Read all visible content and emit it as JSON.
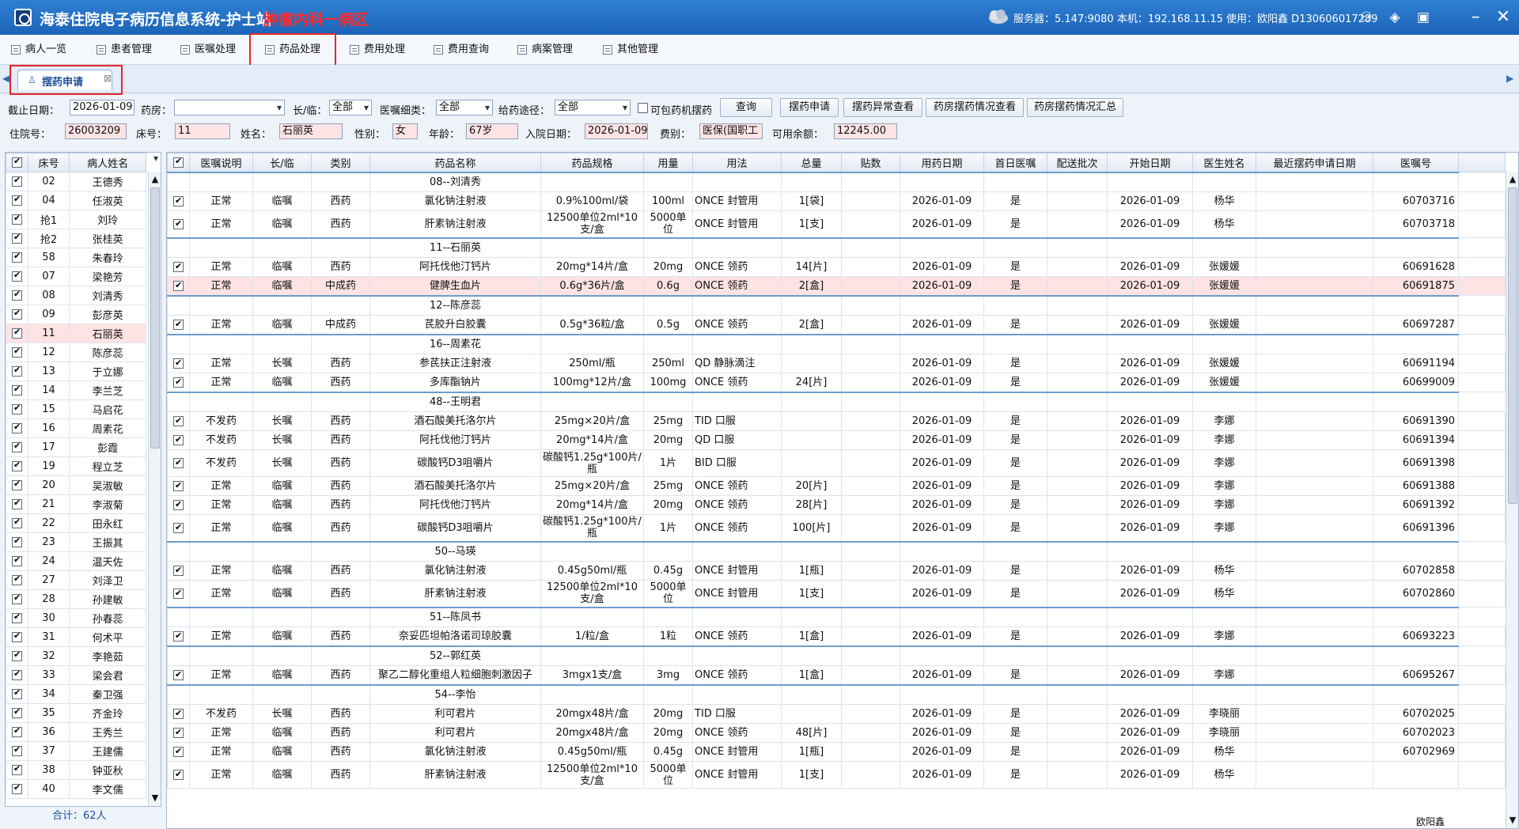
{
  "app": {
    "title": "海泰住院电子病历信息系统-护士站",
    "department": "肿瘤内科一病区",
    "server_info": "服务器：5.147:9080 本机：192.168.11.15 使用：欧阳鑫 D130606017289"
  },
  "menu": {
    "items": [
      "病人一览",
      "患者管理",
      "医嘱处理",
      "药品处理",
      "费用处理",
      "费用查询",
      "病案管理",
      "其他管理"
    ],
    "active_index": 3
  },
  "tab": {
    "label": "摆药申请",
    "close": "⊠"
  },
  "filters": {
    "cutoff_date_label": "截止日期：",
    "cutoff_date": "2026-01-09",
    "pharmacy_label": "药房：",
    "pharmacy": "",
    "longterm_label": "长/临：",
    "longterm": "全部",
    "order_type_label": "医嘱细类：",
    "order_type": "全部",
    "route_label": "给药途径：",
    "route": "全部",
    "include_machine_label": "可包药机摆药",
    "buttons": [
      "查询",
      "摆药申请",
      "摆药异常查看",
      "药房摆药情况查看",
      "药房摆药情况汇总"
    ]
  },
  "patient": {
    "inpatient_no_label": "住院号：",
    "inpatient_no": "26003209",
    "bed_label": "床号：",
    "bed": "11",
    "name_label": "姓名：",
    "name": "石丽英",
    "gender_label": "性别：",
    "gender": "女",
    "age_label": "年龄：",
    "age": "67岁",
    "admit_date_label": "入院日期：",
    "admit_date": "2026-01-09",
    "fee_type_label": "费别：",
    "fee_type": "医保(国职工",
    "balance_label": "可用余额：",
    "balance": "12245.00"
  },
  "left_grid": {
    "headers": [
      "床号",
      "病人姓名"
    ],
    "rows": [
      [
        "02",
        "王德秀"
      ],
      [
        "04",
        "任淑英"
      ],
      [
        "抢1",
        "刘玲"
      ],
      [
        "抢2",
        "张桂英"
      ],
      [
        "58",
        "朱春玲"
      ],
      [
        "07",
        "梁艳芳"
      ],
      [
        "08",
        "刘清秀"
      ],
      [
        "09",
        "彭彦英"
      ],
      [
        "11",
        "石丽英"
      ],
      [
        "12",
        "陈彦蕊"
      ],
      [
        "13",
        "于立娜"
      ],
      [
        "14",
        "李兰芝"
      ],
      [
        "15",
        "马启花"
      ],
      [
        "16",
        "周素花"
      ],
      [
        "17",
        "彭霞"
      ],
      [
        "19",
        "程立芝"
      ],
      [
        "20",
        "吴淑敏"
      ],
      [
        "21",
        "李淑菊"
      ],
      [
        "22",
        "田永红"
      ],
      [
        "23",
        "王振其"
      ],
      [
        "24",
        "温天佐"
      ],
      [
        "27",
        "刘泽卫"
      ],
      [
        "28",
        "孙建敏"
      ],
      [
        "30",
        "孙春蕊"
      ],
      [
        "31",
        "何术平"
      ],
      [
        "32",
        "李艳茹"
      ],
      [
        "33",
        "梁会君"
      ],
      [
        "34",
        "秦卫强"
      ],
      [
        "35",
        "齐金玲"
      ],
      [
        "36",
        "王秀兰"
      ],
      [
        "37",
        "王建儒"
      ],
      [
        "38",
        "钟亚秋"
      ],
      [
        "40",
        "李文儒"
      ]
    ],
    "selected_index": 8,
    "total": "合计：62人"
  },
  "right_grid": {
    "headers": [
      "医嘱说明",
      "长/临",
      "类别",
      "药品名称",
      "药品规格",
      "用量",
      "用法",
      "总量",
      "贴数",
      "用药日期",
      "首日医嘱",
      "配送批次",
      "开始日期",
      "医生姓名",
      "最近摆药申请日期",
      "医嘱号"
    ],
    "rows": [
      {
        "group": "08--刘清秀"
      },
      {
        "c": [
          "正常",
          "临嘱",
          "西药",
          "氯化钠注射液",
          "0.9%100ml/袋",
          "100ml",
          "ONCE 封管用",
          "1[袋]",
          "",
          "2026-01-09",
          "是",
          "",
          "2026-01-09",
          "杨华",
          "",
          "60703716"
        ]
      },
      {
        "c": [
          "正常",
          "临嘱",
          "西药",
          "肝素钠注射液",
          "12500单位2ml*10支/盒",
          "5000单位",
          "ONCE 封管用",
          "1[支]",
          "",
          "2026-01-09",
          "是",
          "",
          "2026-01-09",
          "杨华",
          "",
          "60703718"
        ],
        "tall": true
      },
      {
        "group": "11--石丽英"
      },
      {
        "c": [
          "正常",
          "临嘱",
          "西药",
          "阿托伐他汀钙片",
          "20mg*14片/盒",
          "20mg",
          "ONCE 领药",
          "14[片]",
          "",
          "2026-01-09",
          "是",
          "",
          "2026-01-09",
          "张媛媛",
          "",
          "60691628"
        ]
      },
      {
        "c": [
          "正常",
          "临嘱",
          "中成药",
          "健脾生血片",
          "0.6g*36片/盒",
          "0.6g",
          "ONCE 领药",
          "2[盒]",
          "",
          "2026-01-09",
          "是",
          "",
          "2026-01-09",
          "张媛媛",
          "",
          "60691875"
        ],
        "hl": true
      },
      {
        "group": "12--陈彦蕊"
      },
      {
        "c": [
          "正常",
          "临嘱",
          "中成药",
          "芪胶升白胶囊",
          "0.5g*36粒/盒",
          "0.5g",
          "ONCE 领药",
          "2[盒]",
          "",
          "2026-01-09",
          "是",
          "",
          "2026-01-09",
          "张媛媛",
          "",
          "60697287"
        ]
      },
      {
        "group": "16--周素花"
      },
      {
        "c": [
          "正常",
          "长嘱",
          "西药",
          "参芪扶正注射液",
          "250ml/瓶",
          "250ml",
          "QD 静脉滴注",
          "",
          "",
          "2026-01-09",
          "是",
          "",
          "2026-01-09",
          "张媛媛",
          "",
          "60691194"
        ]
      },
      {
        "c": [
          "正常",
          "临嘱",
          "西药",
          "多库酯钠片",
          "100mg*12片/盒",
          "100mg",
          "ONCE 领药",
          "24[片]",
          "",
          "2026-01-09",
          "是",
          "",
          "2026-01-09",
          "张媛媛",
          "",
          "60699009"
        ]
      },
      {
        "group": "48--王明君"
      },
      {
        "c": [
          "不发药",
          "长嘱",
          "西药",
          "酒石酸美托洛尔片",
          "25mg×20片/盒",
          "25mg",
          "TID 口服",
          "",
          "",
          "2026-01-09",
          "是",
          "",
          "2026-01-09",
          "李娜",
          "",
          "60691390"
        ]
      },
      {
        "c": [
          "不发药",
          "长嘱",
          "西药",
          "阿托伐他汀钙片",
          "20mg*14片/盒",
          "20mg",
          "QD 口服",
          "",
          "",
          "2026-01-09",
          "是",
          "",
          "2026-01-09",
          "李娜",
          "",
          "60691394"
        ]
      },
      {
        "c": [
          "不发药",
          "长嘱",
          "西药",
          "碳酸钙D3咀嚼片",
          "碳酸钙1.25g*100片/瓶",
          "1片",
          "BID 口服",
          "",
          "",
          "2026-01-09",
          "是",
          "",
          "2026-01-09",
          "李娜",
          "",
          "60691398"
        ],
        "tall": true
      },
      {
        "c": [
          "正常",
          "临嘱",
          "西药",
          "酒石酸美托洛尔片",
          "25mg×20片/盒",
          "25mg",
          "ONCE 领药",
          "20[片]",
          "",
          "2026-01-09",
          "是",
          "",
          "2026-01-09",
          "李娜",
          "",
          "60691388"
        ]
      },
      {
        "c": [
          "正常",
          "临嘱",
          "西药",
          "阿托伐他汀钙片",
          "20mg*14片/盒",
          "20mg",
          "ONCE 领药",
          "28[片]",
          "",
          "2026-01-09",
          "是",
          "",
          "2026-01-09",
          "李娜",
          "",
          "60691392"
        ]
      },
      {
        "c": [
          "正常",
          "临嘱",
          "西药",
          "碳酸钙D3咀嚼片",
          "碳酸钙1.25g*100片/瓶",
          "1片",
          "ONCE 领药",
          "100[片]",
          "",
          "2026-01-09",
          "是",
          "",
          "2026-01-09",
          "李娜",
          "",
          "60691396"
        ],
        "tall": true
      },
      {
        "group": "50--马瑛"
      },
      {
        "c": [
          "正常",
          "临嘱",
          "西药",
          "氯化钠注射液",
          "0.45g50ml/瓶",
          "0.45g",
          "ONCE 封管用",
          "1[瓶]",
          "",
          "2026-01-09",
          "是",
          "",
          "2026-01-09",
          "杨华",
          "",
          "60702858"
        ]
      },
      {
        "c": [
          "正常",
          "临嘱",
          "西药",
          "肝素钠注射液",
          "12500单位2ml*10支/盒",
          "5000单位",
          "ONCE 封管用",
          "1[支]",
          "",
          "2026-01-09",
          "是",
          "",
          "2026-01-09",
          "杨华",
          "",
          "60702860"
        ],
        "tall": true
      },
      {
        "group": "51--陈凤书"
      },
      {
        "c": [
          "正常",
          "临嘱",
          "西药",
          "奈妥匹坦帕洛诺司琼胶囊",
          "1/粒/盒",
          "1粒",
          "ONCE 领药",
          "1[盒]",
          "",
          "2026-01-09",
          "是",
          "",
          "2026-01-09",
          "李娜",
          "",
          "60693223"
        ]
      },
      {
        "group": "52--郭红英"
      },
      {
        "c": [
          "正常",
          "临嘱",
          "西药",
          "聚乙二醇化重组人粒细胞刺激因子",
          "3mgx1支/盒",
          "3mg",
          "ONCE 领药",
          "1[盒]",
          "",
          "2026-01-09",
          "是",
          "",
          "2026-01-09",
          "李娜",
          "",
          "60695267"
        ]
      },
      {
        "group": "54--李怡"
      },
      {
        "c": [
          "不发药",
          "长嘱",
          "西药",
          "利可君片",
          "20mgx48片/盒",
          "20mg",
          "TID 口服",
          "",
          "",
          "2026-01-09",
          "是",
          "",
          "2026-01-09",
          "李晓丽",
          "",
          "60702025"
        ]
      },
      {
        "c": [
          "正常",
          "临嘱",
          "西药",
          "利可君片",
          "20mgx48片/盒",
          "20mg",
          "ONCE 领药",
          "48[片]",
          "",
          "2026-01-09",
          "是",
          "",
          "2026-01-09",
          "李晓丽",
          "",
          "60702023"
        ]
      },
      {
        "c": [
          "正常",
          "临嘱",
          "西药",
          "氯化钠注射液",
          "0.45g50ml/瓶",
          "0.45g",
          "ONCE 封管用",
          "1[瓶]",
          "",
          "2026-01-09",
          "是",
          "",
          "2026-01-09",
          "杨华",
          "",
          "60702969"
        ]
      },
      {
        "c": [
          "正常",
          "临嘱",
          "西药",
          "肝素钠注射液",
          "12500单位2ml*10支/盒",
          "5000单位",
          "ONCE 封管用",
          "1[支]",
          "",
          "2026-01-09",
          "是",
          "",
          "2026-01-09",
          "杨华",
          "",
          ""
        ],
        "tall": true
      }
    ]
  },
  "status": {
    "user": "欧阳鑫"
  }
}
